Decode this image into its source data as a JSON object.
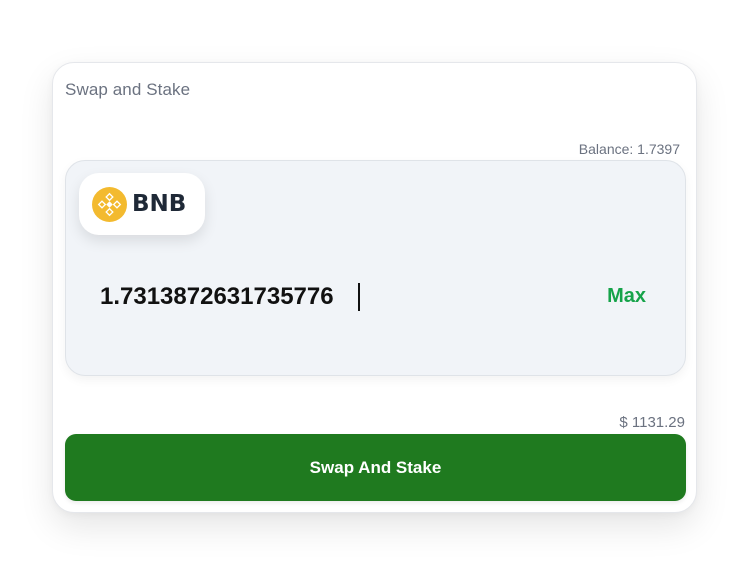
{
  "card": {
    "title": "Swap and Stake"
  },
  "balance": {
    "text": "Balance: 1.7397"
  },
  "token": {
    "symbol": "BNB",
    "icon": "bnb-icon",
    "icon_color": "#F3BA2F"
  },
  "amount": {
    "value": "1.7313872631735776",
    "placeholder": ""
  },
  "max_label": "Max",
  "usd_value": "$ 1131.29",
  "swap_button_label": "Swap And Stake",
  "colors": {
    "accent_green": "#16a34a",
    "button_green": "#1f7a1f",
    "panel_bg": "#f1f4f8"
  }
}
